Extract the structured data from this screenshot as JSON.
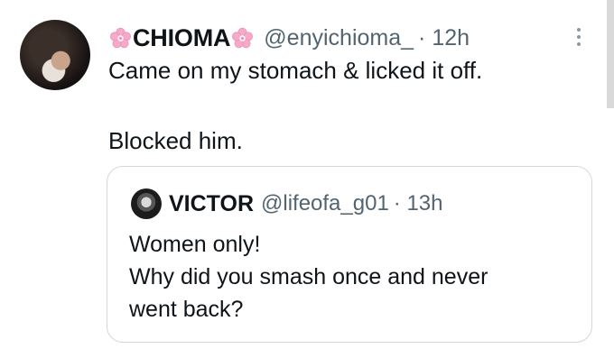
{
  "tweet": {
    "display_name": "CHIOMA",
    "handle": "@enyichioma_",
    "time": "· 12h",
    "text_line1": "Came on my stomach & licked it off.",
    "text_line2": "Blocked him.",
    "name_emoji_icon": "cherry-blossom-icon",
    "more_icon": "more-vertical-icon"
  },
  "quote": {
    "display_name": "VICTOR",
    "handle": "@lifeofa_g01",
    "time": "· 13h",
    "line1": "Women only!",
    "line2": "Why did you smash once and never",
    "line3": "went back?"
  },
  "colors": {
    "text": "#0f1419",
    "secondary": "#536471",
    "border": "#cfd9de",
    "flower": "#f4a6c8"
  }
}
